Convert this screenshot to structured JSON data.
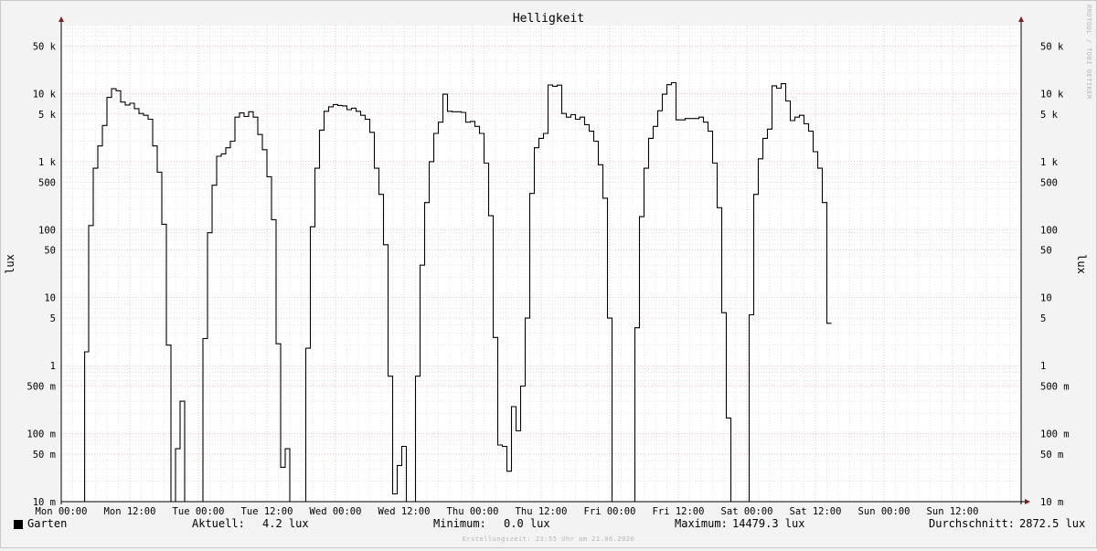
{
  "chart_data": {
    "type": "line",
    "title": "Helligkeit",
    "ylabel": "lux",
    "yscale": "log",
    "ylim": [
      0.01,
      100000
    ],
    "y_tick_labels": [
      {
        "value": 0.01,
        "label": "10 m"
      },
      {
        "value": 0.05,
        "label": "50 m"
      },
      {
        "value": 0.1,
        "label": "100 m"
      },
      {
        "value": 0.5,
        "label": "500 m"
      },
      {
        "value": 1,
        "label": "1"
      },
      {
        "value": 5,
        "label": "5"
      },
      {
        "value": 10,
        "label": "10"
      },
      {
        "value": 50,
        "label": "50"
      },
      {
        "value": 100,
        "label": "100"
      },
      {
        "value": 500,
        "label": "500"
      },
      {
        "value": 1000,
        "label": "1 k"
      },
      {
        "value": 5000,
        "label": "5 k"
      },
      {
        "value": 10000,
        "label": "10 k"
      },
      {
        "value": 50000,
        "label": "50 k"
      }
    ],
    "x_tick_labels": [
      "Mon 00:00",
      "Mon 12:00",
      "Tue 00:00",
      "Tue 12:00",
      "Wed 00:00",
      "Wed 12:00",
      "Thu 00:00",
      "Thu 12:00",
      "Fri 00:00",
      "Fri 12:00",
      "Sat 00:00",
      "Sat 12:00",
      "Sun 00:00",
      "Sun 12:00"
    ],
    "xlim_hours": [
      0,
      168
    ],
    "grid": true,
    "series": [
      {
        "name": "Garten",
        "color": "#000000",
        "step": true,
        "points": [
          [
            0,
            0.005
          ],
          [
            4,
            0.005
          ],
          [
            4.1,
            1.6
          ],
          [
            4.8,
            115
          ],
          [
            5.6,
            800
          ],
          [
            6.4,
            1700
          ],
          [
            7.2,
            3400
          ],
          [
            8,
            8800
          ],
          [
            8.8,
            11800
          ],
          [
            9.6,
            11000
          ],
          [
            10.4,
            7500
          ],
          [
            11.2,
            6800
          ],
          [
            12,
            7200
          ],
          [
            12.8,
            6000
          ],
          [
            13.6,
            5100
          ],
          [
            14.4,
            4800
          ],
          [
            15.2,
            4200
          ],
          [
            16,
            1700
          ],
          [
            16.8,
            700
          ],
          [
            17.6,
            120
          ],
          [
            18.4,
            2
          ],
          [
            19.2,
            0.005
          ],
          [
            20,
            0.06
          ],
          [
            20.8,
            0.3
          ],
          [
            21.6,
            0.005
          ],
          [
            24,
            0.005
          ],
          [
            24.8,
            2.5
          ],
          [
            25.6,
            90
          ],
          [
            26.4,
            450
          ],
          [
            27.2,
            1200
          ],
          [
            28,
            1300
          ],
          [
            28.8,
            1600
          ],
          [
            29.6,
            2000
          ],
          [
            30.4,
            4500
          ],
          [
            31.2,
            5200
          ],
          [
            32,
            4600
          ],
          [
            32.8,
            5400
          ],
          [
            33.6,
            4500
          ],
          [
            34.4,
            2500
          ],
          [
            35.2,
            1500
          ],
          [
            36,
            600
          ],
          [
            36.8,
            140
          ],
          [
            37.6,
            2.1
          ],
          [
            38.4,
            0.032
          ],
          [
            39.2,
            0.06
          ],
          [
            40,
            0.005
          ],
          [
            42.4,
            0.005
          ],
          [
            42.8,
            1.8
          ],
          [
            43.6,
            110
          ],
          [
            44.4,
            800
          ],
          [
            45.2,
            2900
          ],
          [
            46,
            5500
          ],
          [
            46.8,
            6400
          ],
          [
            47.6,
            6900
          ],
          [
            48.4,
            6700
          ],
          [
            49.2,
            6600
          ],
          [
            50,
            5800
          ],
          [
            50.8,
            6100
          ],
          [
            51.6,
            5500
          ],
          [
            52.4,
            4800
          ],
          [
            53.2,
            4200
          ],
          [
            54,
            2700
          ],
          [
            54.8,
            800
          ],
          [
            55.6,
            330
          ],
          [
            56.4,
            60
          ],
          [
            57.2,
            0.7
          ],
          [
            58,
            0.013
          ],
          [
            58.8,
            0.034
          ],
          [
            59.6,
            0.065
          ],
          [
            60.4,
            0.005
          ],
          [
            61.6,
            0.005
          ],
          [
            62,
            0.7
          ],
          [
            62.8,
            30
          ],
          [
            63.6,
            250
          ],
          [
            64.4,
            1000
          ],
          [
            65.2,
            2600
          ],
          [
            66,
            3800
          ],
          [
            66.8,
            9800
          ],
          [
            67.6,
            5500
          ],
          [
            68.4,
            5400
          ],
          [
            69.2,
            5400
          ],
          [
            70,
            5300
          ],
          [
            70.8,
            3800
          ],
          [
            71.6,
            3900
          ],
          [
            72.4,
            3300
          ],
          [
            73.2,
            2600
          ],
          [
            74,
            950
          ],
          [
            74.8,
            160
          ],
          [
            75.6,
            2.6
          ],
          [
            76.4,
            0.068
          ],
          [
            77.2,
            0.065
          ],
          [
            78,
            0.028
          ],
          [
            78.8,
            0.25
          ],
          [
            79.6,
            0.11
          ],
          [
            80.4,
            0.5
          ],
          [
            81.2,
            5
          ],
          [
            82,
            340
          ],
          [
            82.8,
            1600
          ],
          [
            83.6,
            2200
          ],
          [
            84.4,
            2600
          ],
          [
            85.2,
            13400
          ],
          [
            86,
            12800
          ],
          [
            86.8,
            13300
          ],
          [
            87.6,
            5100
          ],
          [
            88.4,
            4500
          ],
          [
            89.2,
            4900
          ],
          [
            90,
            4200
          ],
          [
            90.8,
            4500
          ],
          [
            91.6,
            3500
          ],
          [
            92.4,
            2800
          ],
          [
            93.2,
            2000
          ],
          [
            94,
            900
          ],
          [
            94.8,
            290
          ],
          [
            95.6,
            5
          ],
          [
            96.4,
            0.005
          ],
          [
            100,
            0.005
          ],
          [
            100.4,
            3.6
          ],
          [
            101.2,
            155
          ],
          [
            102,
            800
          ],
          [
            102.8,
            2200
          ],
          [
            103.6,
            3300
          ],
          [
            104.4,
            5600
          ],
          [
            105.2,
            9800
          ],
          [
            106,
            13500
          ],
          [
            106.8,
            14479
          ],
          [
            107.6,
            4100
          ],
          [
            108.4,
            4100
          ],
          [
            109.2,
            4300
          ],
          [
            110,
            4300
          ],
          [
            110.8,
            4300
          ],
          [
            111.6,
            4500
          ],
          [
            112.4,
            3800
          ],
          [
            113.2,
            2800
          ],
          [
            114,
            950
          ],
          [
            114.8,
            210
          ],
          [
            115.6,
            6
          ],
          [
            116.4,
            0.17
          ],
          [
            117.2,
            0.005
          ],
          [
            120,
            0.005
          ],
          [
            120.4,
            5.6
          ],
          [
            121.2,
            330
          ],
          [
            122,
            1100
          ],
          [
            122.8,
            2200
          ],
          [
            123.6,
            3000
          ],
          [
            124.4,
            13000
          ],
          [
            125.2,
            12000
          ],
          [
            126,
            14000
          ],
          [
            126.8,
            7800
          ],
          [
            127.6,
            4000
          ],
          [
            128.4,
            4500
          ],
          [
            129.2,
            4800
          ],
          [
            130,
            3600
          ],
          [
            130.8,
            2800
          ],
          [
            131.6,
            1400
          ],
          [
            132.4,
            800
          ],
          [
            133.2,
            250
          ],
          [
            134,
            4.2
          ],
          [
            134.8,
            4.2
          ]
        ]
      }
    ],
    "legend": {
      "series_name": "Garten",
      "current_label": "Aktuell:",
      "current_value": "4.2 lux",
      "min_label": "Minimum:",
      "min_value": "0.0 lux",
      "max_label": "Maximum:",
      "max_value": "14479.3 lux",
      "avg_label": "Durchschnitt:",
      "avg_value": "2872.5 lux"
    },
    "watermark": "RRDTOOL / TOBI OETIKER",
    "credit": "Erstellungszeit: 23:55 Uhr am 21.06.2020",
    "colors": {
      "background": "#f3f3f3",
      "plot_area": "#ffffff",
      "major_grid": "#e7a0a8",
      "minor_grid": "#d6d6d6",
      "line": "#000000",
      "axis_arrow": "#8a1a1a"
    }
  }
}
